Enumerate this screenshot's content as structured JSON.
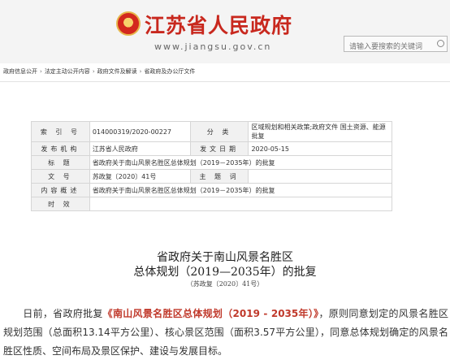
{
  "header": {
    "title": "江苏省人民政府",
    "url": "www.jiangsu.gov.cn",
    "search_placeholder": "请输入要搜索的关键词"
  },
  "breadcrumb": [
    "政府信息公开",
    "法定主动公开内容",
    "政府文件及解读",
    "省政府及办公厅文件"
  ],
  "meta": {
    "index_label": "索 引 号",
    "index_value": "014000319/2020-00227",
    "category_label": "分 类",
    "category_value": "区域规划和相关政策;政府文件 国土资源、能源 批复",
    "publisher_label": "发布机构",
    "publisher_value": "江苏省人民政府",
    "date_label": "发文日期",
    "date_value": "2020-05-15",
    "subject_label": "标 题",
    "subject_value": "省政府关于南山风景名胜区总体规划（2019－2035年）的批复",
    "docno_label": "文 号",
    "docno_value": "苏政复〔2020〕41号",
    "keywords_label": "主 题 词",
    "keywords_value": "",
    "summary_label": "内容概述",
    "summary_value": "省政府关于南山风景名胜区总体规划（2019－2035年）的批复",
    "validity_label": "时 效",
    "validity_value": ""
  },
  "document": {
    "title_line1": "省政府关于南山风景名胜区",
    "title_line2": "总体规划（2019—2035年）的批复",
    "number": "（苏政复〔2020〕41号）",
    "para_before": "日前，省政府批复",
    "para_highlight": "《南山风景名胜区总体规划（2019 - 2035年）》",
    "para_after": "，原则同意划定的风景名胜区规划范围（总面积13.14平方公里）、核心景区范围（面积3.57平方公里），同意总体规划确定的风景名胜区性质、空间布局及景区保护、建设与发展目标。"
  }
}
